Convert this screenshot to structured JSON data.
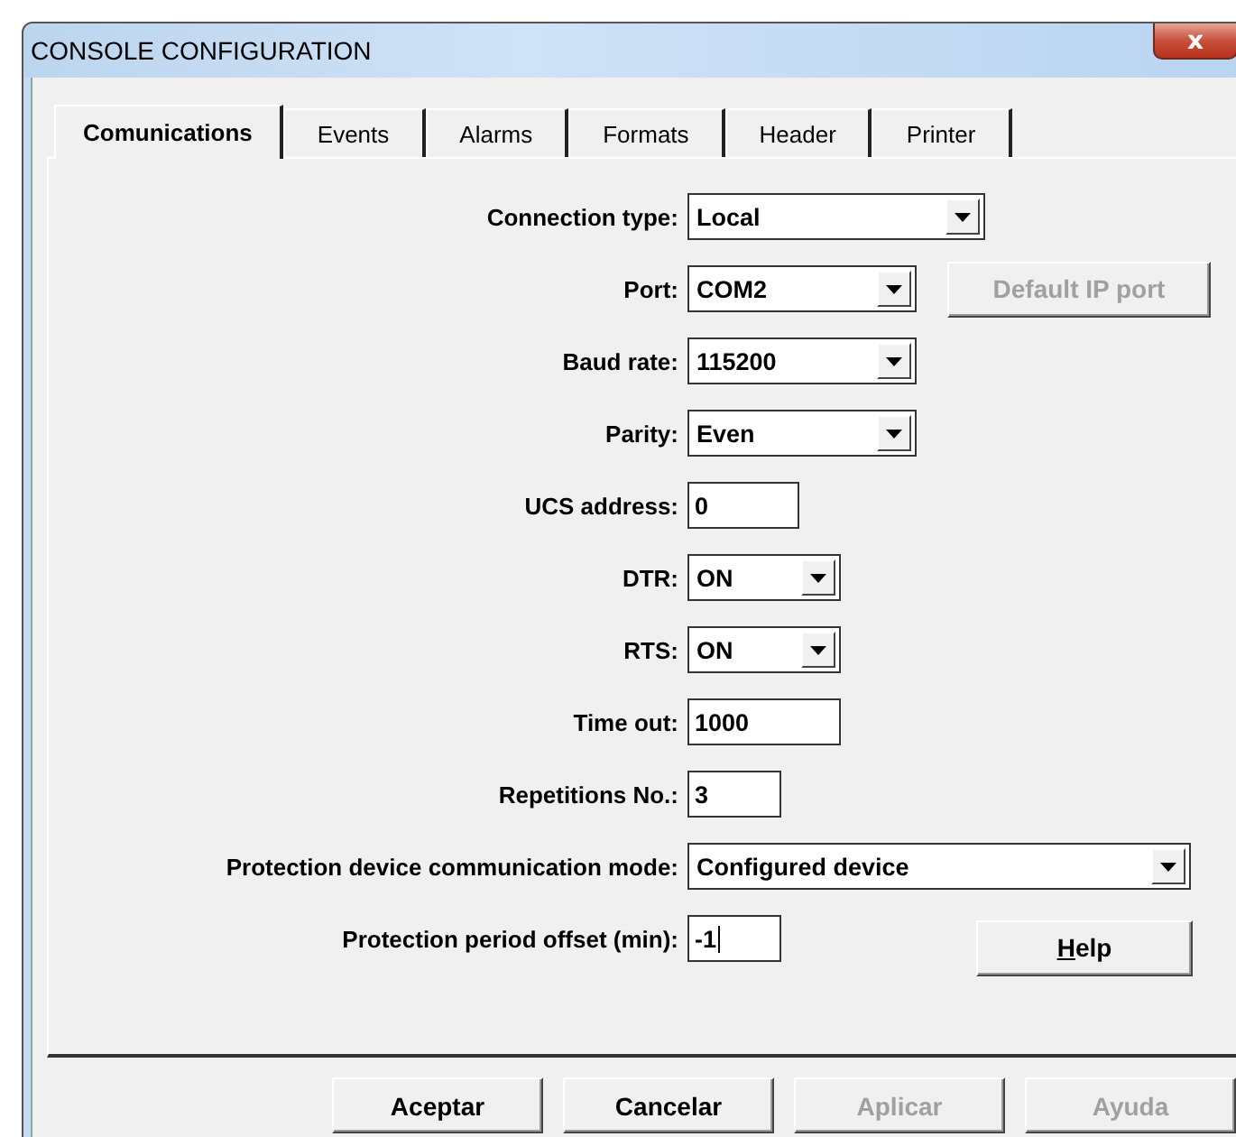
{
  "window": {
    "title": "CONSOLE CONFIGURATION",
    "close": "x"
  },
  "tabs": [
    {
      "label": "Comunications",
      "selected": true
    },
    {
      "label": "Events",
      "selected": false
    },
    {
      "label": "Alarms",
      "selected": false
    },
    {
      "label": "Formats",
      "selected": false
    },
    {
      "label": "Header",
      "selected": false
    },
    {
      "label": "Printer",
      "selected": false
    }
  ],
  "fields": [
    {
      "label": "Connection type:",
      "kind": "select",
      "value": "Local"
    },
    {
      "label": "Port:",
      "kind": "select",
      "value": "COM2",
      "button": {
        "label": "Default IP port",
        "disabled": true
      }
    },
    {
      "label": "Baud rate:",
      "kind": "select",
      "value": "115200"
    },
    {
      "label": "Parity:",
      "kind": "select",
      "value": "Even"
    },
    {
      "label": "UCS address:",
      "kind": "text",
      "value": "0"
    },
    {
      "label": "DTR:",
      "kind": "select",
      "value": "ON"
    },
    {
      "label": "RTS:",
      "kind": "select",
      "value": "ON"
    },
    {
      "label": "Time out:",
      "kind": "text",
      "value": "1000"
    },
    {
      "label": "Repetitions No.:",
      "kind": "text",
      "value": "3"
    },
    {
      "label": "Protection device communication mode:",
      "kind": "select",
      "value": "Configured device"
    },
    {
      "label": "Protection period offset (min):",
      "kind": "text",
      "value": "-1",
      "focused": true,
      "button": {
        "mnemonic": "H",
        "label": "elp",
        "disabled": false
      }
    }
  ],
  "buttons": [
    {
      "label": "Aceptar",
      "disabled": false
    },
    {
      "label": "Cancelar",
      "disabled": false
    },
    {
      "label": "Aplicar",
      "disabled": true
    },
    {
      "label": "Ayuda",
      "disabled": true
    }
  ]
}
